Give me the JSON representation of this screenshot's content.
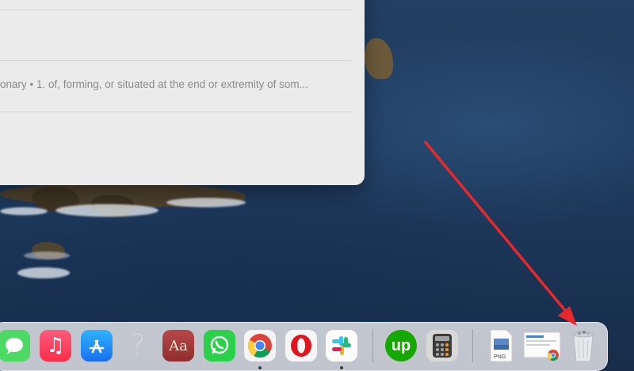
{
  "spotlight": {
    "result_snippet": "onary • 1. of, forming, or situated at the end or extremity of som..."
  },
  "dock": {
    "items": [
      {
        "name": "Messages",
        "icon": "messages-icon",
        "running": false
      },
      {
        "name": "Music",
        "icon": "music-note-icon",
        "running": false
      },
      {
        "name": "App Store",
        "icon": "app-store-icon",
        "running": false
      },
      {
        "name": "Unknown App",
        "icon": "question-mark-icon",
        "running": false
      },
      {
        "name": "Dictionary",
        "icon": "dictionary-icon",
        "label": "Aa",
        "running": false
      },
      {
        "name": "WhatsApp",
        "icon": "whatsapp-icon",
        "running": false
      },
      {
        "name": "Google Chrome",
        "icon": "chrome-icon",
        "running": true
      },
      {
        "name": "Opera",
        "icon": "opera-icon",
        "running": false
      },
      {
        "name": "Slack",
        "icon": "slack-icon",
        "running": true
      },
      {
        "name": "Upwork",
        "icon": "upwork-icon",
        "label": "up",
        "running": false
      },
      {
        "name": "Calculator",
        "icon": "calculator-icon",
        "running": false
      },
      {
        "name": "PNG File",
        "icon": "png-file-icon",
        "label": "PNG",
        "running": false
      },
      {
        "name": "Chrome Document",
        "icon": "chrome-document-icon",
        "running": false
      },
      {
        "name": "Trash",
        "icon": "trash-icon",
        "running": false
      }
    ]
  },
  "annotation": {
    "color": "#e8282a"
  },
  "colors": {
    "messages": "#4cd964",
    "music": "#fa2d55",
    "app_store": "#1a8cf0",
    "dictionary": "#a33a3a",
    "whatsapp": "#2bd04b",
    "opera": "#e3131e",
    "upwork": "#14a800",
    "calculator": "#3b3b3b"
  }
}
